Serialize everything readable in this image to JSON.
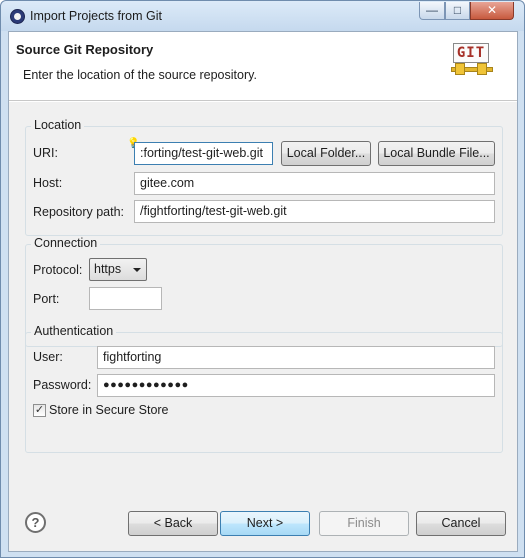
{
  "window": {
    "title": "Import Projects from Git",
    "controls": {
      "minimize": "—",
      "maximize": "□",
      "close": "✕"
    }
  },
  "header": {
    "title": "Source Git Repository",
    "description": "Enter the location of the source repository.",
    "logo_text": "GIT"
  },
  "location": {
    "group_label": "Location",
    "uri_label": "URI:",
    "uri_value": ":forting/test-git-web.git",
    "local_folder_button": "Local Folder...",
    "local_bundle_button": "Local Bundle File...",
    "host_label": "Host:",
    "host_value": "gitee.com",
    "repo_path_label": "Repository path:",
    "repo_path_value": "/fightforting/test-git-web.git"
  },
  "connection": {
    "group_label": "Connection",
    "protocol_label": "Protocol:",
    "protocol_value": "https",
    "port_label": "Port:",
    "port_value": ""
  },
  "authentication": {
    "group_label": "Authentication",
    "user_label": "User:",
    "user_value": "fightforting",
    "password_label": "Password:",
    "password_value": "●●●●●●●●●●●●",
    "store_label": "Store in Secure Store",
    "store_checked": true
  },
  "footer": {
    "help_icon": "?",
    "back_button": "< Back",
    "next_button": "Next >",
    "finish_button": "Finish",
    "cancel_button": "Cancel"
  }
}
